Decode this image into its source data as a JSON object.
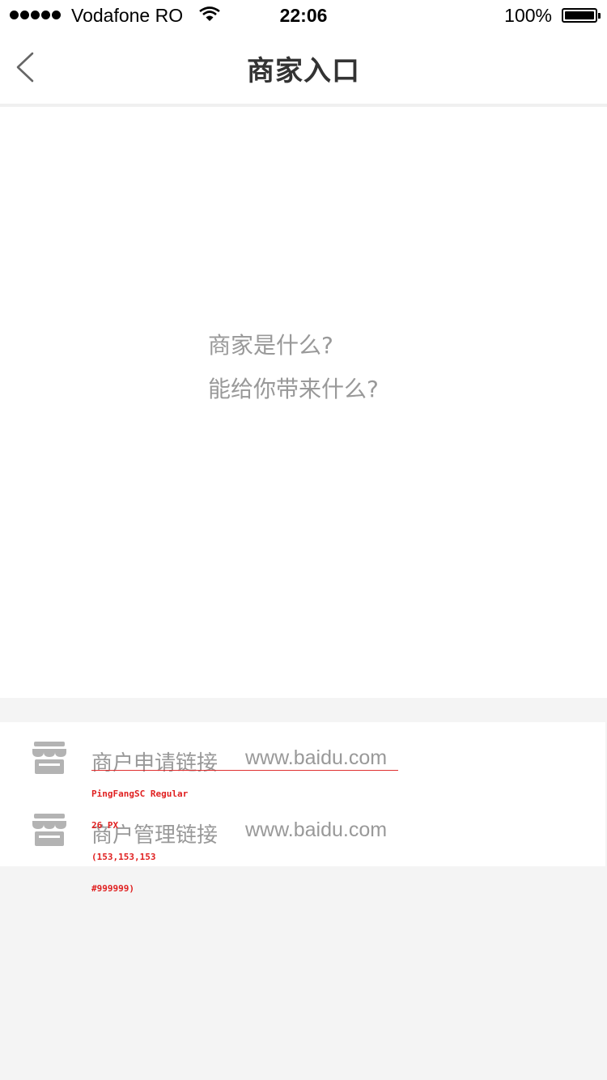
{
  "status_bar": {
    "carrier": "Vodafone RO",
    "time": "22:06",
    "battery": "100%",
    "battery_level": 1.0
  },
  "nav": {
    "title": "商家入口",
    "back_icon": "chevron-left-icon"
  },
  "intro": {
    "line1": "商家是什么?",
    "line2": "能给你带来什么?"
  },
  "links": [
    {
      "icon": "store-icon",
      "label": "商户申请链接",
      "url": "www.baidu.com"
    },
    {
      "icon": "store-icon",
      "label": "商户管理链接",
      "url": "www.baidu.com"
    }
  ],
  "annotation": {
    "lines": [
      "PingFangSC Regular",
      "26 PX",
      "(153,153,153",
      "#999999)"
    ],
    "color": "#e02020"
  },
  "colors": {
    "text_gray": "#999999",
    "title": "#333333",
    "background": "#f4f4f4"
  }
}
